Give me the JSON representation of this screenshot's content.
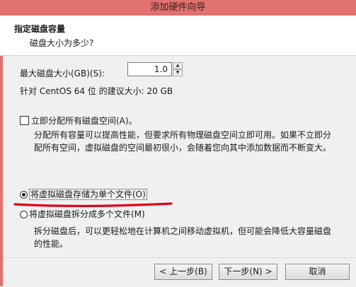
{
  "window": {
    "title": "添加硬件向导"
  },
  "header": {
    "title": "指定磁盘容量",
    "subtitle": "磁盘大小为多少?"
  },
  "size": {
    "label": "最大磁盘大小(GB)(S):",
    "value": "1.0",
    "up_glyph": "▲",
    "down_glyph": "▼",
    "recommendation": "针对 CentOS 64 位 的建议大小: 20 GB"
  },
  "allocate": {
    "label": "立即分配所有磁盘空间(A)。",
    "checked": false,
    "description": "分配所有容量可以提高性能，但要求所有物理磁盘空间立即可用。如果不立即分配所有空间，虚拟磁盘的空间最初很小，会随着您向其中添加数据而不断变大。"
  },
  "storage_options": [
    {
      "label": "将虚拟磁盘存储为单个文件(O)",
      "selected": true
    },
    {
      "label": "将虚拟磁盘拆分成多个文件(M)",
      "selected": false,
      "description": "拆分磁盘后，可以更轻松地在计算机之间移动虚拟机，但可能会降低大容量磁盘的性能。"
    }
  ],
  "buttons": {
    "back": "< 上一步(B)",
    "next": "下一步(N) >",
    "cancel": "取消"
  },
  "colors": {
    "titlebar": "#e0716e",
    "annotation_underline": "#e0001a"
  }
}
